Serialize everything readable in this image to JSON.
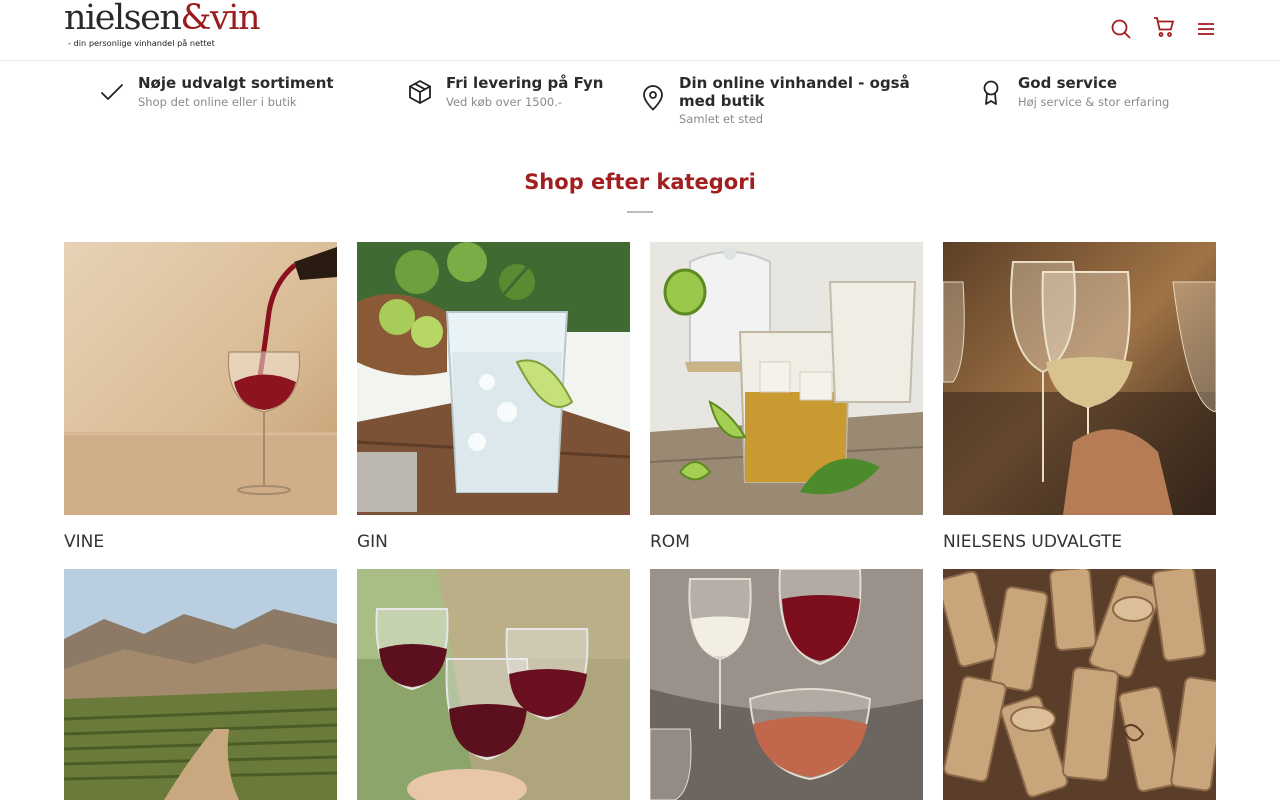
{
  "header": {
    "logo": {
      "name": "nielsen",
      "amp": "&",
      "vin": "vin",
      "tagline": "- din personlige vinhandel på nettet"
    },
    "icons": [
      "search-icon",
      "cart-icon",
      "menu-icon"
    ]
  },
  "usps": [
    {
      "title": "Nøje udvalgt sortiment",
      "subtitle": "Shop det online eller i butik",
      "icon": "check-icon"
    },
    {
      "title": "Fri levering på Fyn",
      "subtitle": "Ved køb over 1500.-",
      "icon": "package-icon"
    },
    {
      "title": "Din online vinhandel - også med butik",
      "subtitle": "Samlet et sted",
      "icon": "map-pin-icon"
    },
    {
      "title": "God service",
      "subtitle": "Høj service & stor erfaring",
      "icon": "award-icon"
    }
  ],
  "section": {
    "title": "Shop efter kategori"
  },
  "categories": [
    {
      "label": "VINE"
    },
    {
      "label": "GIN"
    },
    {
      "label": "ROM"
    },
    {
      "label": "NIELSENS UDVALGTE"
    },
    {
      "label": ""
    },
    {
      "label": ""
    },
    {
      "label": ""
    },
    {
      "label": ""
    }
  ],
  "colors": {
    "brand": "#a11f1f",
    "text": "#2b2b2b",
    "muted": "#8a8a8a"
  }
}
